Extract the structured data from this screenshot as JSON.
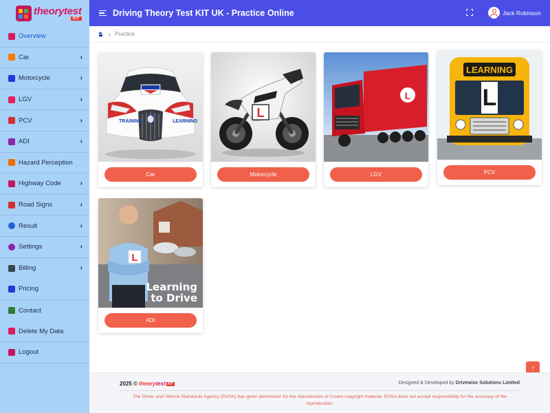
{
  "logo": {
    "word_a": "theory",
    "word_b": "test",
    "kit": "KIT"
  },
  "header": {
    "title": "Driving Theory Test KIT UK - Practice Online",
    "user_name": "Jack Robinson"
  },
  "sidebar": {
    "items": [
      {
        "label": "Overview",
        "icon": "grid-icon",
        "color": "#d81b60",
        "has_submenu": false,
        "active": true
      },
      {
        "label": "Car",
        "icon": "car-icon",
        "color": "#f57c00",
        "has_submenu": true
      },
      {
        "label": "Motorcycle",
        "icon": "motorcycle-icon",
        "color": "#1e3ad8",
        "has_submenu": true
      },
      {
        "label": "LGV",
        "icon": "truck-icon",
        "color": "#e91e63",
        "has_submenu": true
      },
      {
        "label": "PCV",
        "icon": "bus-icon",
        "color": "#d32f2f",
        "has_submenu": true
      },
      {
        "label": "ADI",
        "icon": "instructor-icon",
        "color": "#8e24aa",
        "has_submenu": true
      },
      {
        "label": "Hazard Perception",
        "icon": "hazard-icon",
        "color": "#ef6c00",
        "has_submenu": false
      },
      {
        "label": "Highway Code",
        "icon": "book-icon",
        "color": "#c2185b",
        "has_submenu": true
      },
      {
        "label": "Road Signs",
        "icon": "road-sign-icon",
        "color": "#d32f2f",
        "has_submenu": true
      },
      {
        "label": "Result",
        "icon": "info-icon",
        "color": "#1e63d8",
        "has_submenu": true
      },
      {
        "label": "Settings",
        "icon": "settings-icon",
        "color": "#8e24aa",
        "has_submenu": true
      },
      {
        "label": "Billing",
        "icon": "billing-icon",
        "color": "#37474f",
        "has_submenu": true
      },
      {
        "label": "Pricing",
        "icon": "pricing-icon",
        "color": "#1e3ad8",
        "has_submenu": false
      },
      {
        "label": "Contact",
        "icon": "contact-icon",
        "color": "#2e7d32",
        "has_submenu": false
      },
      {
        "label": "Delete My Data",
        "icon": "delete-icon",
        "color": "#d81b60",
        "has_submenu": false
      },
      {
        "label": "Logout",
        "icon": "logout-icon",
        "color": "#c2185b",
        "has_submenu": false
      }
    ]
  },
  "breadcrumb": {
    "current": "Practice"
  },
  "cards": [
    {
      "label": "Car"
    },
    {
      "label": "Motorcycle"
    },
    {
      "label": "LGV"
    },
    {
      "label": "PCV"
    },
    {
      "label": "ADI"
    }
  ],
  "images": {
    "car_plate_left": "TRAINING",
    "car_plate_right": "LEARNING",
    "bus_sign": "LEARNING",
    "adi_line1": "Learning",
    "adi_line2": "to Drive",
    "l_plate": "L"
  },
  "footer": {
    "year": "2025 ©",
    "brand_a": "theory",
    "brand_b": "test",
    "brand_kit": "KIT",
    "designed_prefix": "Designed & Developed by",
    "designed_company": "Drivewise Solutions Limited",
    "disclaimer": "The Driver and Vehicle Standards Agency (DVSA) has given permission for the reproduction of Crown copyright material. DVSA does not accept responsibility for the accuracy of the reproduction."
  },
  "colors": {
    "sidebar_bg": "#a8d2f8",
    "topbar_bg": "#4a4ee6",
    "accent": "#f0604a"
  }
}
